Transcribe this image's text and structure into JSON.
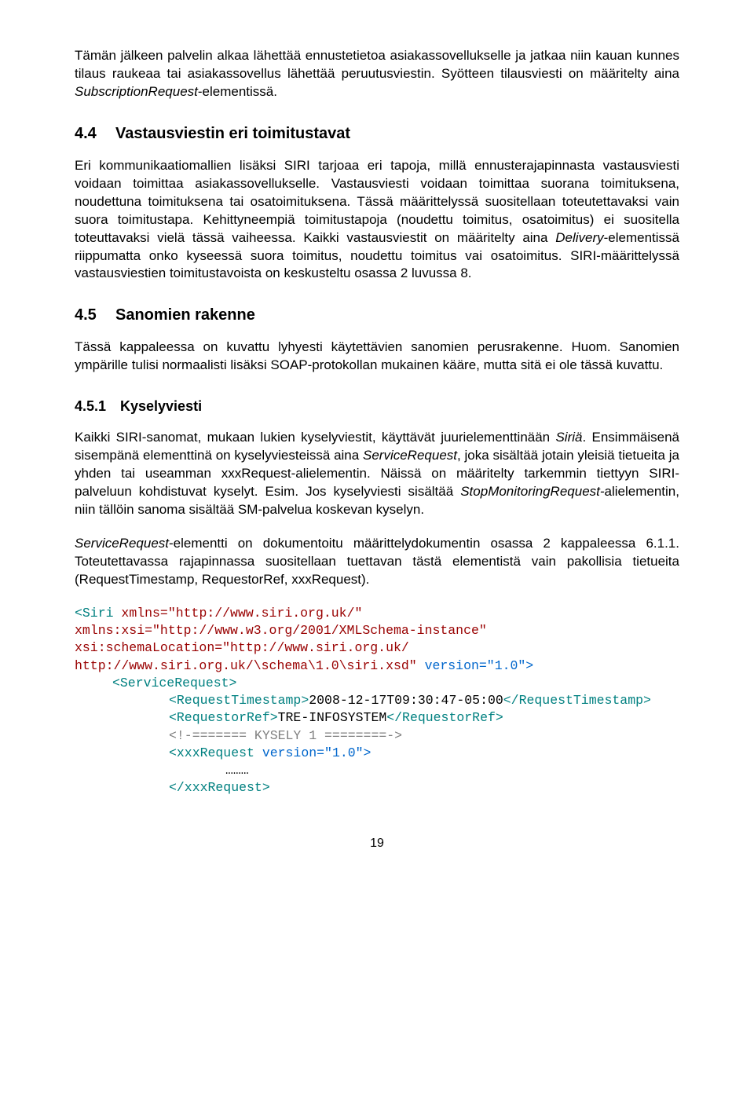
{
  "p1a": "Tämän jälkeen palvelin alkaa lähettää ennustetietoa asiakassovellukselle ja jatkaa niin kauan kunnes tilaus raukeaa tai asiakassovellus lähettää peruutusviestin. Syötteen tilausviesti on määritelty aina ",
  "p1b": "SubscriptionRequest",
  "p1c": "-elementissä.",
  "h44_num": "4.4",
  "h44_title": "Vastausviestin eri toimitustavat",
  "p2a": "Eri kommunikaatiomallien lisäksi SIRI tarjoaa eri tapoja, millä ennusterajapinnasta vastausviesti voidaan toimittaa asiakassovellukselle. Vastausviesti voidaan toimittaa suorana toimituksena, noudettuna toimituksena tai osatoimituksena. Tässä määrittelyssä suositellaan toteutettavaksi vain suora toimitustapa. Kehittyneempiä toimitustapoja (noudettu toimitus, osatoimitus) ei suositella toteuttavaksi vielä tässä vaiheessa. Kaikki vastausviestit on määritelty aina ",
  "p2b": "Delivery",
  "p2c": "-elementissä riippumatta onko kyseessä suora toimitus, noudettu toimitus vai osatoimitus. SIRI-määrittelyssä  vastausviestien toimitustavoista on keskusteltu osassa 2 luvussa 8.",
  "h45_num": "4.5",
  "h45_title": "Sanomien rakenne",
  "p3": "Tässä kappaleessa on kuvattu lyhyesti käytettävien sanomien perusrakenne. Huom. Sanomien ympärille tulisi normaalisti lisäksi SOAP-protokollan mukainen kääre, mutta sitä ei ole tässä kuvattu.",
  "h451_num": "4.5.1",
  "h451_title": "Kyselyviesti",
  "p4a": "Kaikki SIRI-sanomat, mukaan lukien kyselyviestit, käyttävät juurielementtinään ",
  "p4b": "Siriä",
  "p4c": ". Ensimmäisenä sisempänä elementtinä on kyselyviesteissä aina ",
  "p4d": "ServiceRequest",
  "p4e": ", joka sisältää jotain yleisiä tietueita ja yhden tai useamman xxxRequest-alielementin. Näissä on määritelty tarkemmin tiettyyn SIRI-palveluun kohdistuvat kyselyt. Esim. Jos kyselyviesti sisältää ",
  "p4f": "StopMonitoringRequest-",
  "p4g": "alielementin, niin tällöin sanoma sisältää SM-palvelua koskevan kyselyn.",
  "p5a": "ServiceRequest",
  "p5b": "-elementti on dokumentoitu määrittelydokumentin osassa 2 kappaleessa 6.1.1. Toteutettavassa rajapinnassa suositellaan tuettavan tästä elementistä vain pakollisia tietueita (RequestTimestamp, RequestorRef, xxxRequest).",
  "code": {
    "l1a": "<Siri ",
    "l1b": "xmlns=\"http://www.siri.org.uk/\"",
    "l2": "xmlns:xsi=\"http://www.w3.org/2001/XMLSchema-instance\"",
    "l3": "xsi:schemaLocation=\"http://www.siri.org.uk/",
    "l4a": "http://www.siri.org.uk/\\schema\\1.0\\siri.xsd\" ",
    "l4b": "version=\"1.0\">",
    "l5": "<ServiceRequest>",
    "l6a": "<RequestTimestamp>",
    "l6b": "2008-12-17T09:30:47-05:00",
    "l6c": "</RequestTimestamp>",
    "l7a": "<RequestorRef>",
    "l7b": "TRE-INFOSYSTEM",
    "l7c": "</RequestorRef>",
    "l8": "<!-======= KYSELY 1 ========->",
    "l9a": "<xxxRequest ",
    "l9b": "version=\"1.0\">",
    "l10": "………",
    "l11": "</xxxRequest>"
  },
  "pagenum": "19"
}
